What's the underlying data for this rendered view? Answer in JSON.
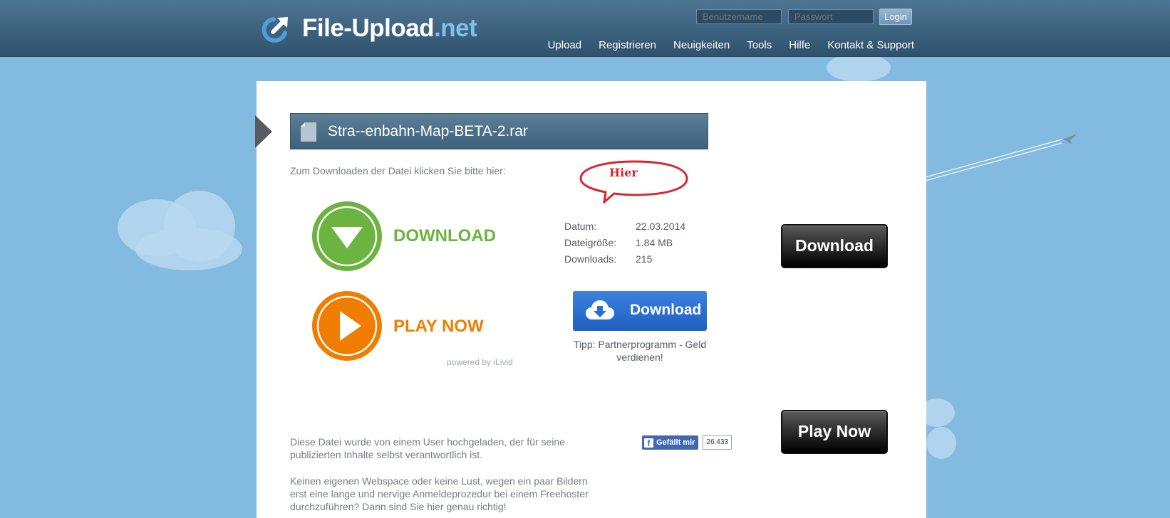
{
  "header": {
    "logo": {
      "name": "File-Upload",
      "tld": ".net"
    },
    "login": {
      "username_placeholder": "Benutzername",
      "password_placeholder": "Passwort",
      "button_label": "Login"
    },
    "nav": [
      "Upload",
      "Registrieren",
      "Neuigkeiten",
      "Tools",
      "Hilfe",
      "Kontakt & Support"
    ]
  },
  "file": {
    "title": "Stra--enbahn-Map-BETA-2.rar",
    "instruction": "Zum Downloaden der Datei klicken Sie bitte hier:",
    "annotation": "Hier",
    "meta": [
      {
        "label": "Datum:",
        "value": "22.03.2014"
      },
      {
        "label": "Dateigröße:",
        "value": "1.84 MB"
      },
      {
        "label": "Downloads:",
        "value": "215"
      }
    ]
  },
  "ads": {
    "download_label": "DOWNLOAD",
    "play_label": "PLAY NOW",
    "powered_by": "powered by iLivid",
    "blue_button_label": "Download",
    "tip": "Tipp: Partnerprogramm - Geld verdienen!",
    "black_download_label": "Download",
    "black_play_label": "Play Now"
  },
  "social": {
    "like_label": "Gefällt mir",
    "like_count": "26.433"
  },
  "footer_text": {
    "disclaimer": "Diese Datei wurde von einem User hochgeladen, der für seine publizierten Inhalte selbst verantwortlich ist.",
    "promo": "Keinen eigenen Webspace oder keine Lust, wegen ein paar Bildern erst eine lange und nervige Anmeldeprozedur bei einem Freehoster durchzuführen? Dann sind Sie hier genau richtig!"
  },
  "colors": {
    "sky": "#82bae0",
    "header": "#3d627c",
    "green": "#6cb33f",
    "orange": "#f07c00",
    "annotation_red": "#d9262f"
  }
}
